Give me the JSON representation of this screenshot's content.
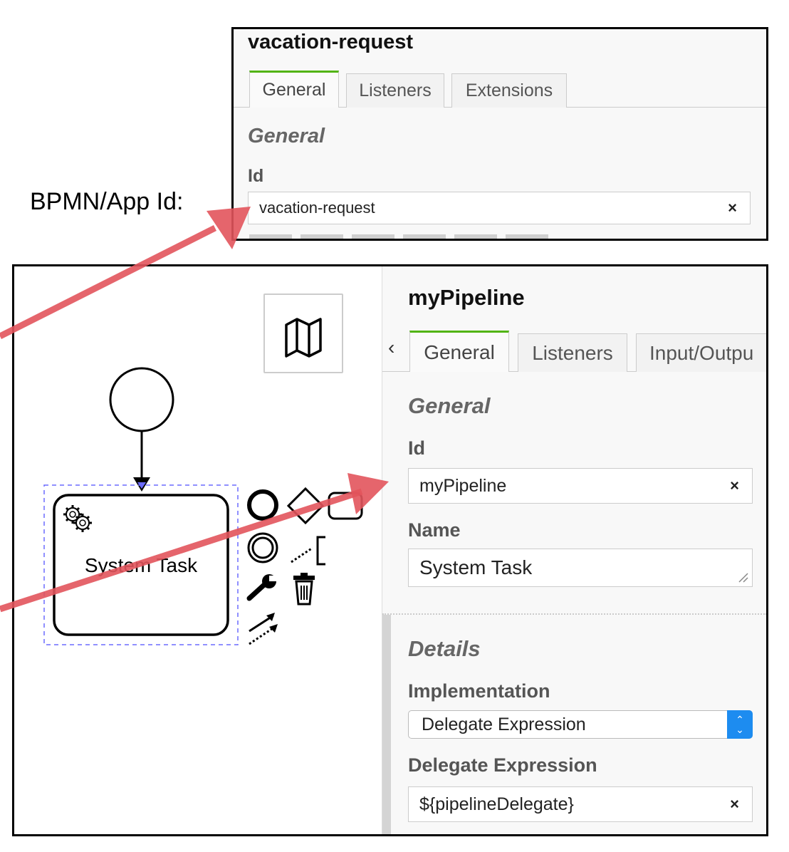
{
  "side_label": "BPMN/App Id:",
  "process_panel": {
    "title": "vacation-request",
    "tabs": [
      {
        "label": "General",
        "active": true
      },
      {
        "label": "Listeners",
        "active": false
      },
      {
        "label": "Extensions",
        "active": false
      }
    ],
    "group_header": "General",
    "id_label": "Id",
    "id_value": "vacation-request",
    "clear_symbol": "×"
  },
  "canvas": {
    "task_label": "System Task",
    "icons": [
      "gear-icon",
      "map-icon",
      "end-event-icon",
      "gateway-icon",
      "task-icon",
      "intermediate-event-icon",
      "text-annotation-icon",
      "wrench-icon",
      "trash-icon",
      "connect-icon"
    ]
  },
  "task_panel": {
    "title": "myPipeline",
    "scroll_left": "‹",
    "tabs": [
      {
        "label": "General",
        "active": true
      },
      {
        "label": "Listeners",
        "active": false
      },
      {
        "label": "Input/Outpu",
        "active": false
      }
    ],
    "group_general": "General",
    "id_label": "Id",
    "id_value": "myPipeline",
    "name_label": "Name",
    "name_value": "System Task",
    "group_details": "Details",
    "implementation_label": "Implementation",
    "implementation_value": "Delegate Expression",
    "delegate_label": "Delegate Expression",
    "delegate_value": "${pipelineDelegate}",
    "clear_symbol": "×"
  },
  "colors": {
    "accent_tab": "#52b415",
    "arrow": "#e2545c",
    "select_blue": "#1d8cf0",
    "selection_dash": "#6b6bff"
  }
}
